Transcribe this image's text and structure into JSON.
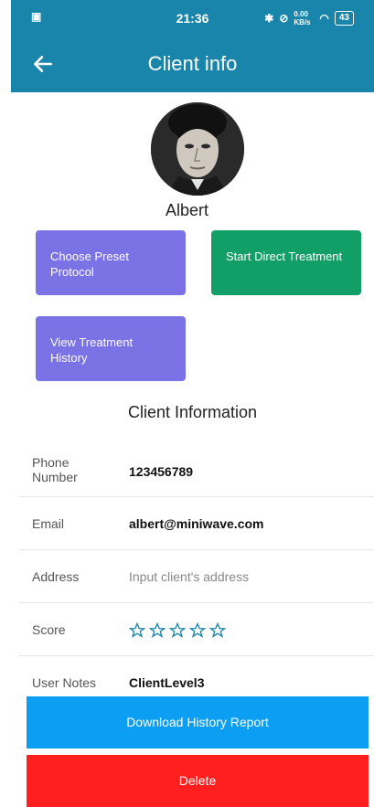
{
  "status_bar": {
    "time": "21:36",
    "left_icon": "sim-icon",
    "network": "0.00 KB/s",
    "battery": "43"
  },
  "header": {
    "title": "Client info",
    "back_icon": "arrow-left-icon"
  },
  "client": {
    "name": "Albert"
  },
  "actions": {
    "preset_label": "Choose Preset Protocol",
    "direct_label": "Start Direct Treatment",
    "history_label": "View Treatment History"
  },
  "info": {
    "section_title": "Client Information",
    "phone_label": "Phone Number",
    "phone_value": "123456789",
    "email_label": "Email",
    "email_value": "albert@miniwave.com",
    "address_label": "Address",
    "address_placeholder": "Input client's address",
    "score_label": "Score",
    "score_stars": 0,
    "notes_label": "User Notes",
    "notes_value": "ClientLevel3"
  },
  "footer": {
    "download_label": "Download History Report",
    "delete_label": "Delete"
  },
  "colors": {
    "appbar": "#1a85ab",
    "purple": "#7b72e6",
    "green": "#129e67",
    "blue": "#0b9ef2",
    "red": "#ff1f1f",
    "star": "#1a85ab"
  }
}
